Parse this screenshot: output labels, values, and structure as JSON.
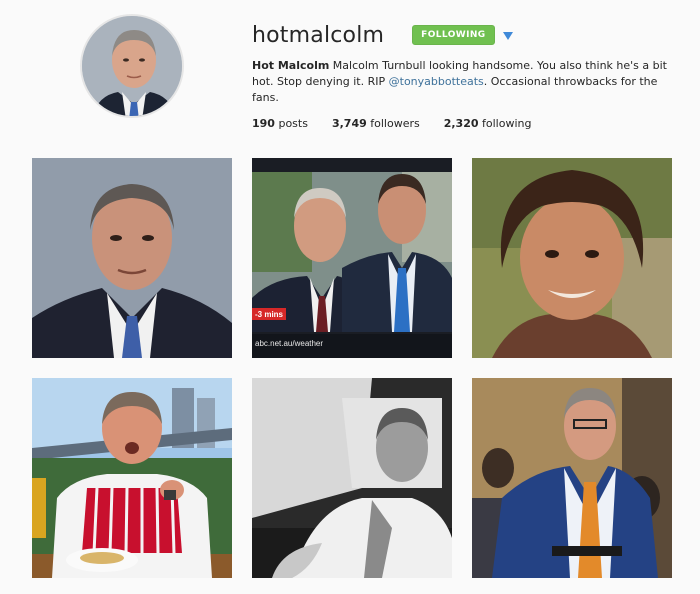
{
  "profile": {
    "username": "hotmalcolm",
    "follow_button_label": "FOLLOWING",
    "dropdown_icon": "caret-down-icon",
    "bio_name": "Hot Malcolm",
    "bio_text_1": " Malcolm Turnbull looking handsome. You also think he's a bit hot. Stop denying it. RIP ",
    "bio_mention": "@tonyabbotteats",
    "bio_text_2": ". Occasional throwbacks for the fans.",
    "stats": {
      "posts_count": "190",
      "posts_label": " posts",
      "followers_count": "3,749",
      "followers_label": " followers",
      "following_count": "2,320",
      "following_label": " following"
    }
  },
  "posts": [
    {
      "alt": "post-1"
    },
    {
      "alt": "post-2",
      "overlay_badge": "-3 mins",
      "overlay_url": "abc.net.au/weather"
    },
    {
      "alt": "post-3"
    },
    {
      "alt": "post-4"
    },
    {
      "alt": "post-5"
    },
    {
      "alt": "post-6"
    }
  ],
  "colors": {
    "follow_green": "#70c050",
    "mention_blue": "#3f729b",
    "caret_blue": "#3f89d8",
    "background": "#fafafa"
  }
}
